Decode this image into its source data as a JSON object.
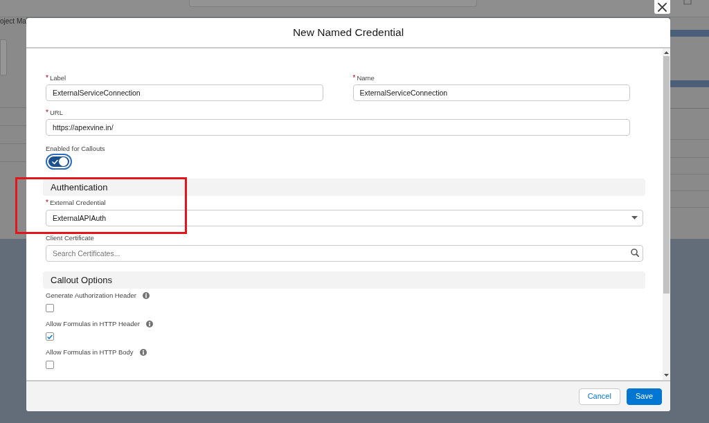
{
  "background": {
    "tab_label": "oject Ma"
  },
  "dialog": {
    "title": "New Named Credential"
  },
  "field_rows": [
    {
      "fields": [
        {
          "asterisk": "*",
          "label": "Label",
          "value": "ExternalServiceConnection"
        },
        {
          "asterisk": "*",
          "label": "Name",
          "value": "ExternalServiceConnection"
        }
      ]
    },
    {
      "fields": [
        {
          "asterisk": "*",
          "label": "URL",
          "value": "https://apexvine.in/"
        }
      ]
    }
  ],
  "toggle": {
    "label": "Enabled for Callouts",
    "on": true
  },
  "sections": [
    {
      "title": "Authentication",
      "items": [
        {
          "kind": "combobox",
          "asterisk": "*",
          "label": "External Credential",
          "value": "ExternalAPIAuth"
        },
        {
          "kind": "search",
          "label": "Client Certificate",
          "placeholder": "Search Certificates..."
        }
      ]
    },
    {
      "title": "Callout Options",
      "items": [
        {
          "kind": "checkbox",
          "label": "Generate Authorization Header",
          "info": true,
          "checked": false
        },
        {
          "kind": "checkbox",
          "label": "Allow Formulas in HTTP Header",
          "info": true,
          "checked": true
        },
        {
          "kind": "checkbox",
          "label": "Allow Formulas in HTTP Body",
          "info": true,
          "checked": false
        }
      ]
    }
  ],
  "annotation": {
    "kind": "box"
  },
  "footer": {
    "buttons": [
      {
        "label": "Cancel",
        "kind": "neutral"
      },
      {
        "label": "Save",
        "kind": "brand"
      }
    ]
  }
}
